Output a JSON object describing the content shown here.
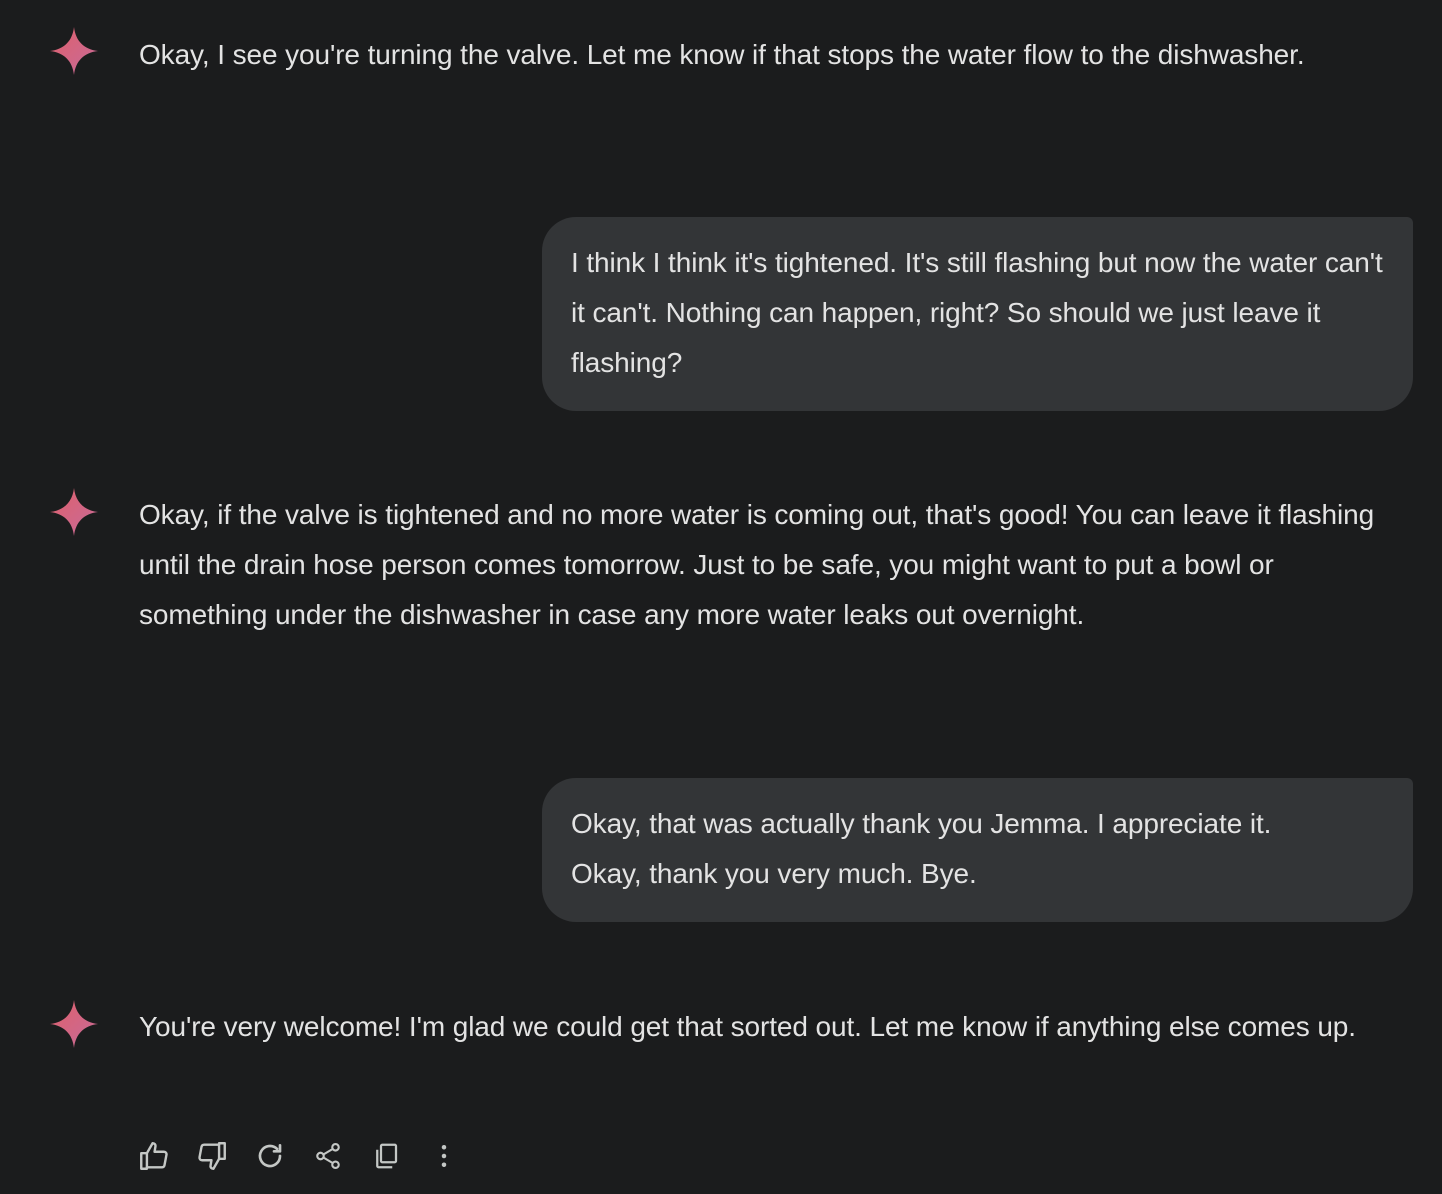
{
  "conversation": {
    "turns": [
      {
        "role": "model",
        "text": "Okay, I see you're turning the valve. Let me know if that stops the water flow to the dishwasher."
      },
      {
        "role": "user",
        "text": "I think I think it's tightened. It's still flashing but now the water can't it can't. Nothing can happen, right? So should we just leave it flashing?"
      },
      {
        "role": "model",
        "text": "Okay, if the valve is tightened and no more water is coming out, that's good! You can leave it flashing until the drain hose person comes tomorrow. Just to be safe, you might want to put a bowl or something under the dishwasher in case any more water leaks out overnight."
      },
      {
        "role": "user",
        "text": "Okay, that was actually thank you Jemma. I appreciate it. Okay, thank you very much. Bye."
      },
      {
        "role": "model",
        "text": "You're very welcome! I'm glad we could get that sorted out. Let me know if anything else comes up."
      }
    ]
  },
  "actions": {
    "icons": [
      "thumb-up-icon",
      "thumb-down-icon",
      "regenerate-icon",
      "share-icon",
      "copy-icon",
      "more-vert-icon"
    ]
  },
  "colors": {
    "background": "#1b1c1d",
    "user_bubble": "#333537",
    "text": "#e3e3e3",
    "icon": "#c4c7c5",
    "spark_start": "#d96570",
    "spark_end": "#9b72cb"
  }
}
